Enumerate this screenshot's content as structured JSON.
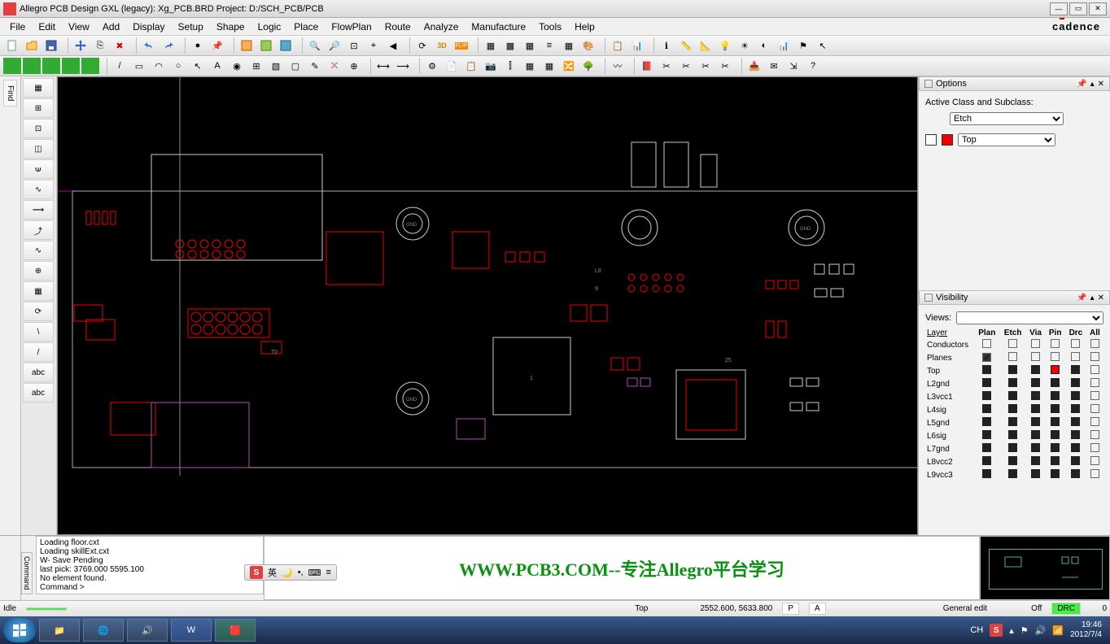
{
  "titlebar": {
    "text": "Allegro PCB Design GXL (legacy): Xg_PCB.BRD   Project: D:/SCH_PCB/PCB"
  },
  "menus": [
    "File",
    "Edit",
    "View",
    "Add",
    "Display",
    "Setup",
    "Shape",
    "Logic",
    "Place",
    "FlowPlan",
    "Route",
    "Analyze",
    "Manufacture",
    "Tools",
    "Help"
  ],
  "brand": "cādence",
  "options": {
    "title": "Options",
    "heading": "Active Class and Subclass:",
    "class": "Etch",
    "subclass": "Top"
  },
  "visibility": {
    "title": "Visibility",
    "views_label": "Views:",
    "layer_label": "Layer",
    "headers": [
      "Plan",
      "Etch",
      "Via",
      "Pin",
      "Drc",
      "All"
    ],
    "rows1": [
      {
        "label": "Conductors"
      },
      {
        "label": "Planes"
      }
    ],
    "rows2": [
      {
        "label": "Top"
      },
      {
        "label": "L2gnd"
      },
      {
        "label": "L3vcc1"
      },
      {
        "label": "L4sig"
      },
      {
        "label": "L5gnd"
      },
      {
        "label": "L6sig"
      },
      {
        "label": "L7gnd"
      },
      {
        "label": "L8vcc2"
      },
      {
        "label": "L9vcc3"
      }
    ]
  },
  "left_tab": "Find",
  "command_log": [
    "Loading floor.cxt",
    "Loading skillExt.cxt",
    "W- Save Pending",
    "last pick: 3769.000 5595.100",
    "No element found.",
    "Command >"
  ],
  "watermark": "WWW.PCB3.COM--专注Allegro平台学习",
  "status": {
    "mode": "Idle",
    "layer": "Top",
    "coords": "2552.600, 5633.800",
    "p": "P",
    "a": "A",
    "edit": "General edit",
    "off": "Off",
    "drc": "DRC",
    "count": "0"
  },
  "ime": {
    "s": "S",
    "lang": "英"
  },
  "tray": {
    "ch": "CH",
    "time": "19:46",
    "date": "2012/7/4"
  }
}
